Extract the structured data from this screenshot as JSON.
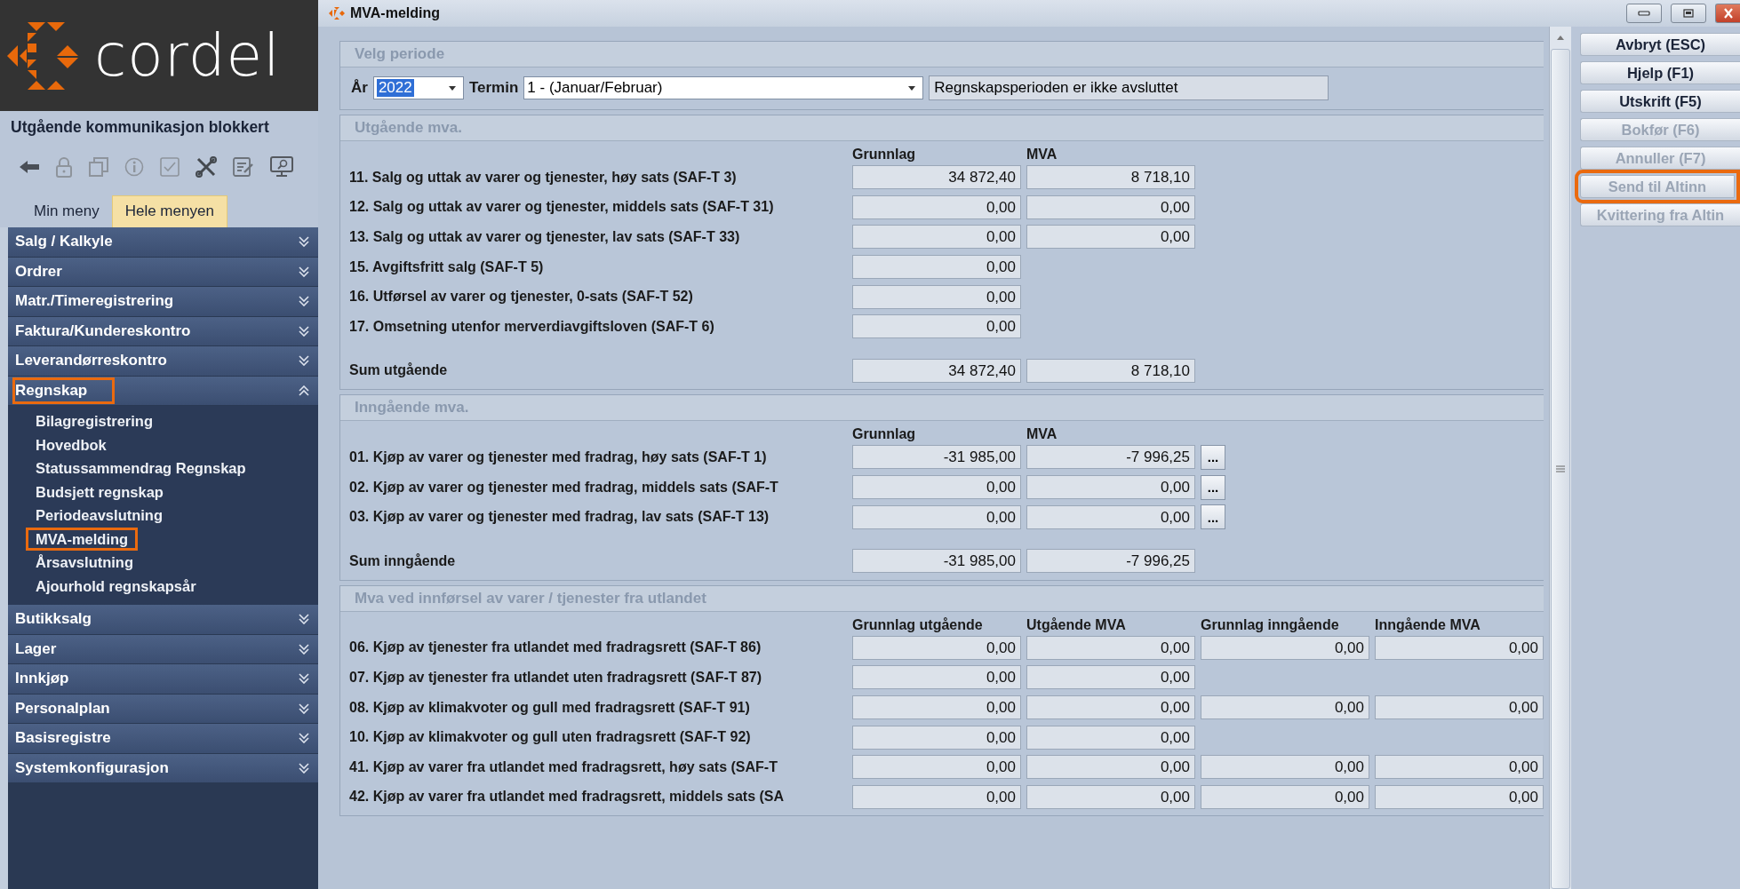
{
  "sidebar": {
    "logo_text": "cordel",
    "notice": "Utgående kommunikasjon blokkert",
    "tabs": [
      {
        "label": "Min meny",
        "selected": false
      },
      {
        "label": "Hele menyen",
        "selected": true
      }
    ],
    "groups": [
      {
        "label": "Salg / Kalkyle",
        "expanded": false,
        "highlighted": false
      },
      {
        "label": "Ordrer",
        "expanded": false,
        "highlighted": false
      },
      {
        "label": "Matr./Timeregistrering",
        "expanded": false,
        "highlighted": false
      },
      {
        "label": "Faktura/Kundereskontro",
        "expanded": false,
        "highlighted": false
      },
      {
        "label": "Leverandørreskontro",
        "expanded": false,
        "highlighted": false
      },
      {
        "label": "Regnskap",
        "expanded": true,
        "highlighted": true,
        "children": [
          {
            "label": "Bilagregistrering",
            "highlighted": false
          },
          {
            "label": "Hovedbok",
            "highlighted": false
          },
          {
            "label": "Statussammendrag Regnskap",
            "highlighted": false
          },
          {
            "label": "Budsjett regnskap",
            "highlighted": false
          },
          {
            "label": "Periodeavslutning",
            "highlighted": false
          },
          {
            "label": "MVA-melding",
            "highlighted": true
          },
          {
            "label": "Årsavslutning",
            "highlighted": false
          },
          {
            "label": "Ajourhold regnskapsår",
            "highlighted": false
          }
        ]
      },
      {
        "label": "Butikksalg",
        "expanded": false,
        "highlighted": false
      },
      {
        "label": "Lager",
        "expanded": false,
        "highlighted": false
      },
      {
        "label": "Innkjøp",
        "expanded": false,
        "highlighted": false
      },
      {
        "label": "Personalplan",
        "expanded": false,
        "highlighted": false
      },
      {
        "label": "Basisregistre",
        "expanded": false,
        "highlighted": false
      },
      {
        "label": "Systemkonfigurasjon",
        "expanded": false,
        "highlighted": false
      }
    ]
  },
  "window": {
    "title": "MVA-melding"
  },
  "period": {
    "title": "Velg periode",
    "year_label": "År",
    "year": "2022",
    "termin_label": "Termin",
    "termin": "1 - (Januar/Februar)",
    "status": "Regnskapsperioden er ikke avsluttet"
  },
  "sections": [
    {
      "title": "Utgående mva.",
      "columns": [
        "Grunnlag",
        "MVA"
      ],
      "rows": [
        {
          "label": "11. Salg og uttak av varer og tjenester, høy sats (SAF-T 3)",
          "values": [
            "34 872,40",
            "8 718,10"
          ]
        },
        {
          "label": "12. Salg og uttak av varer og tjenester, middels sats (SAF-T 31)",
          "values": [
            "0,00",
            "0,00"
          ]
        },
        {
          "label": "13. Salg og uttak av varer og tjenester, lav sats (SAF-T 33)",
          "values": [
            "0,00",
            "0,00"
          ]
        },
        {
          "label": "15. Avgiftsfritt salg (SAF-T 5)",
          "values": [
            "0,00"
          ]
        },
        {
          "label": "16. Utførsel av varer og tjenester, 0-sats (SAF-T 52)",
          "values": [
            "0,00"
          ]
        },
        {
          "label": "17. Omsetning utenfor merverdiavgiftsloven (SAF-T 6)",
          "values": [
            "0,00"
          ]
        }
      ],
      "sum": {
        "label": "Sum utgående",
        "values": [
          "34 872,40",
          "8 718,10"
        ]
      }
    },
    {
      "title": "Inngående mva.",
      "columns": [
        "Grunnlag",
        "MVA"
      ],
      "rows": [
        {
          "label": "01. Kjøp av varer og tjenester med fradrag, høy sats (SAF-T 1)",
          "values": [
            "-31 985,00",
            "-7 996,25"
          ],
          "more_button": "..."
        },
        {
          "label": "02. Kjøp av varer og tjenester med fradrag, middels sats (SAF-T",
          "values": [
            "0,00",
            "0,00"
          ],
          "more_button": "..."
        },
        {
          "label": "03. Kjøp av varer og tjenester med fradrag, lav sats (SAF-T 13)",
          "values": [
            "0,00",
            "0,00"
          ],
          "more_button": "..."
        }
      ],
      "sum": {
        "label": "Sum inngående",
        "values": [
          "-31 985,00",
          "-7 996,25"
        ]
      }
    },
    {
      "title": "Mva ved innførsel av varer / tjenester fra utlandet",
      "columns": [
        "Grunnlag utgående",
        "Utgående MVA",
        "Grunnlag inngående",
        "Inngående MVA"
      ],
      "rows": [
        {
          "label": "06. Kjøp av tjenester fra utlandet med fradragsrett (SAF-T 86)",
          "values": [
            "0,00",
            "0,00",
            "0,00",
            "0,00"
          ]
        },
        {
          "label": "07. Kjøp av tjenester fra utlandet uten fradragsrett (SAF-T 87)",
          "values": [
            "0,00",
            "0,00"
          ]
        },
        {
          "label": "08. Kjøp av klimakvoter og gull med fradragsrett (SAF-T 91)",
          "values": [
            "0,00",
            "0,00",
            "0,00",
            "0,00"
          ]
        },
        {
          "label": "10. Kjøp av klimakvoter og gull uten fradragsrett (SAF-T 92)",
          "values": [
            "0,00",
            "0,00"
          ]
        },
        {
          "label": "41. Kjøp av varer fra utlandet med fradragsrett, høy sats (SAF-T",
          "values": [
            "0,00",
            "0,00",
            "0,00",
            "0,00"
          ]
        },
        {
          "label": "42. Kjøp av varer fra utlandet med fradragsrett, middels sats (SA",
          "values": [
            "0,00",
            "0,00",
            "0,00",
            "0,00"
          ]
        }
      ]
    }
  ],
  "buttons": [
    {
      "label": "Avbryt (ESC)",
      "disabled": false,
      "highlighted": false
    },
    {
      "label": "Hjelp (F1)",
      "disabled": false,
      "highlighted": false
    },
    {
      "label": "Utskrift (F5)",
      "disabled": false,
      "highlighted": false
    },
    {
      "label": "Bokfør (F6)",
      "disabled": true,
      "highlighted": false
    },
    {
      "label": "Annuller (F7)",
      "disabled": true,
      "highlighted": false
    },
    {
      "label": "Send til Altinn",
      "disabled": true,
      "highlighted": true
    },
    {
      "label": "Kvittering fra Altin",
      "disabled": true,
      "highlighted": false
    }
  ]
}
